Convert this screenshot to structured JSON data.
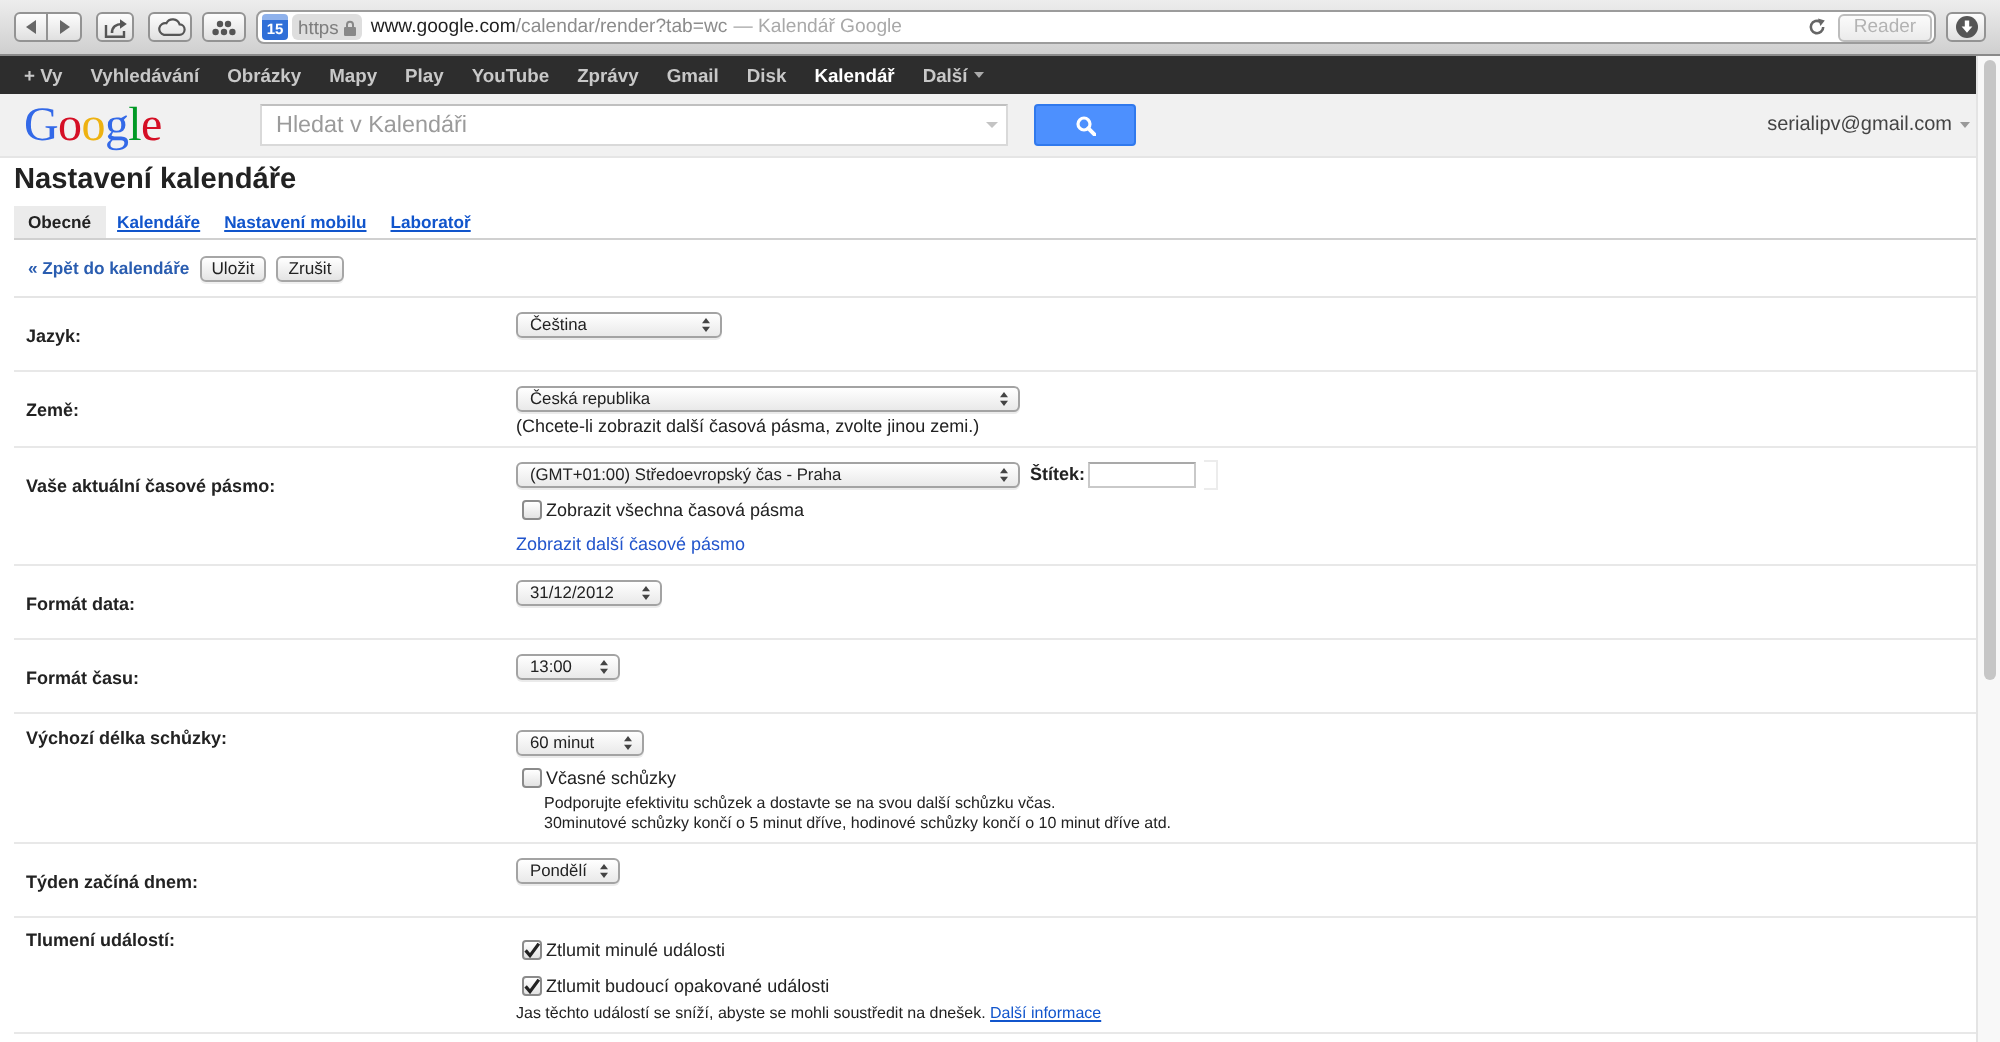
{
  "browser": {
    "tab_badge": "15",
    "scheme": "https",
    "host": "www.google.com",
    "path": "/calendar/render?tab=wc",
    "page_title": "— Kalendář Google",
    "reader_button": "Reader"
  },
  "google_bar": {
    "items": [
      {
        "label": "+ Vy",
        "selected": false,
        "kind": "link"
      },
      {
        "label": "Vyhledávání",
        "selected": false,
        "kind": "link"
      },
      {
        "label": "Obrázky",
        "selected": false,
        "kind": "link"
      },
      {
        "label": "Mapy",
        "selected": false,
        "kind": "link"
      },
      {
        "label": "Play",
        "selected": false,
        "kind": "link"
      },
      {
        "label": "YouTube",
        "selected": false,
        "kind": "link"
      },
      {
        "label": "Zprávy",
        "selected": false,
        "kind": "link"
      },
      {
        "label": "Gmail",
        "selected": false,
        "kind": "link"
      },
      {
        "label": "Disk",
        "selected": false,
        "kind": "link"
      },
      {
        "label": "Kalendář",
        "selected": true,
        "kind": "link"
      },
      {
        "label": "Další",
        "selected": false,
        "kind": "menu"
      }
    ]
  },
  "header": {
    "logo": "Google",
    "search": {
      "placeholder": "Hledat v Kalendáři"
    },
    "account": "serialipv@gmail.com"
  },
  "title": "Nastavení kalendáře",
  "tabs": [
    {
      "label": "Obecné",
      "selected": true
    },
    {
      "label": "Kalendáře",
      "selected": false
    },
    {
      "label": "Nastavení mobilu",
      "selected": false
    },
    {
      "label": "Laboratoř",
      "selected": false
    }
  ],
  "actions": {
    "back_link": "« Zpět do kalendáře",
    "buttons": [
      "Uložit",
      "Zrušit"
    ]
  },
  "settings": [
    {
      "label": "Jazyk:",
      "controls": [
        {
          "kind": "select",
          "value": "Čeština"
        }
      ]
    },
    {
      "label": "Země:",
      "controls": [
        {
          "kind": "select",
          "value": "Česká republika"
        },
        {
          "kind": "note",
          "text": "(Chcete-li zobrazit další časová pásma, zvolte jinou zemi.)"
        }
      ]
    },
    {
      "label": "Vaše aktuální časové pásmo:",
      "controls": [
        {
          "kind": "select",
          "value": "(GMT+01:00) Středoevropský čas - Praha",
          "tag_label": "Štítek:"
        },
        {
          "kind": "checkbox",
          "label": "Zobrazit všechna časová pásma",
          "checked": false
        },
        {
          "kind": "link",
          "text": "Zobrazit další časové pásmo"
        }
      ]
    },
    {
      "label": "Formát data:",
      "controls": [
        {
          "kind": "select",
          "value": "31/12/2012"
        }
      ]
    },
    {
      "label": "Formát času:",
      "controls": [
        {
          "kind": "select",
          "value": "13:00"
        }
      ]
    },
    {
      "label": "Výchozí délka schůzky:",
      "controls": [
        {
          "kind": "select",
          "value": "60 minut"
        },
        {
          "kind": "checkbox",
          "label": "Včasné schůzky",
          "checked": false,
          "description": [
            "Podporujte efektivitu schůzek a dostavte se na svou další schůzku včas.",
            "30minutové schůzky končí o 5 minut dříve, hodinové schůzky končí o 10 minut dříve atd."
          ]
        }
      ]
    },
    {
      "label": "Týden začíná dnem:",
      "controls": [
        {
          "kind": "select",
          "value": "Pondělí"
        }
      ]
    },
    {
      "label": "Tlumení událostí:",
      "controls": [
        {
          "kind": "checkbox",
          "label": "Ztlumit minulé události",
          "checked": true
        },
        {
          "kind": "checkbox",
          "label": "Ztlumit budoucí opakované události",
          "checked": true
        },
        {
          "kind": "hint",
          "text": "Jas těchto událostí se sníží, abyste se mohli soustředit na dnešek.",
          "link": "Další informace"
        }
      ]
    }
  ]
}
